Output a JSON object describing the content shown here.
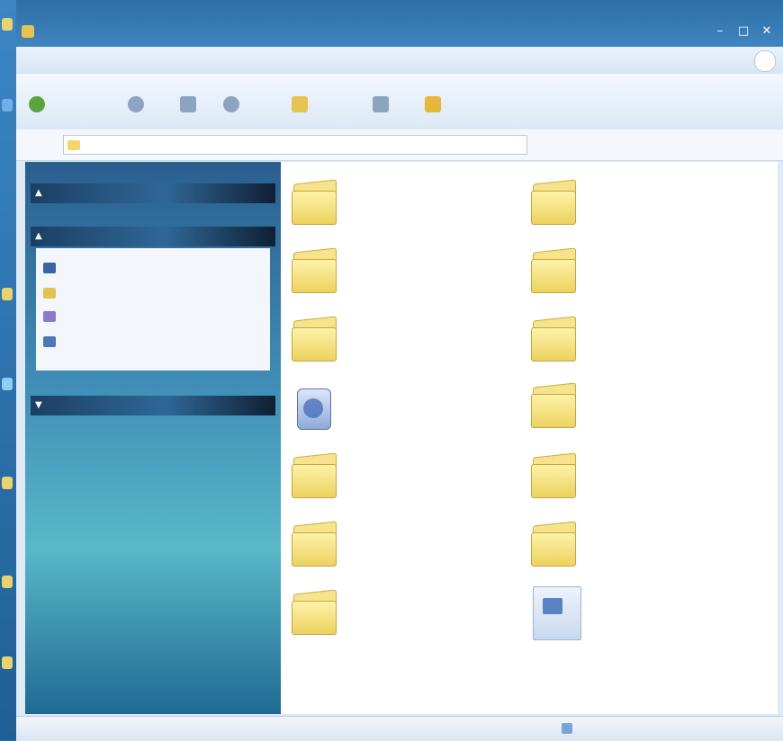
{
  "window": {
    "title": "",
    "controls": {
      "minimize": "–",
      "maximize": "□",
      "close": "✕"
    }
  },
  "menubar": {
    "items": [
      "",
      "",
      "",
      "",
      "",
      ""
    ]
  },
  "toolbar": {
    "buttons": [
      {
        "label": "",
        "icon": "back-arrow-icon",
        "color": "#5aa441"
      },
      {
        "label": "",
        "icon": "forward-arrow-icon",
        "color": "#8aa4c2"
      },
      {
        "label": "",
        "icon": "up-folder-icon",
        "color": "#8aa4c2"
      },
      {
        "label": "",
        "icon": "search-icon",
        "color": "#8aa4c2"
      },
      {
        "label": "",
        "icon": "folders-icon",
        "color": "#e6c44f"
      },
      {
        "label": "",
        "icon": "views-icon",
        "color": "#8aa4c2"
      },
      {
        "label": "",
        "icon": "folder-sync-icon",
        "color": "#e6b73a"
      }
    ]
  },
  "address": {
    "label": "",
    "value": "",
    "go": "",
    "links": ""
  },
  "taskpane": {
    "headers": [
      "",
      "",
      ""
    ],
    "tasks": [
      {
        "label": "",
        "icon": "new-folder-icon",
        "color": "#3c63a8"
      },
      {
        "label": "",
        "icon": "publish-icon",
        "color": "#e3c24f"
      },
      {
        "label": "",
        "icon": "share-icon",
        "color": "#8a7ad0"
      },
      {
        "label": "",
        "icon": "search-icon",
        "color": "#4c78b8"
      }
    ]
  },
  "items": [
    {
      "label": "",
      "type": "folder"
    },
    {
      "label": "",
      "type": "folder"
    },
    {
      "label": "",
      "type": "folder"
    },
    {
      "label": "",
      "type": "folder"
    },
    {
      "label": "",
      "type": "folder"
    },
    {
      "label": "",
      "type": "folder"
    },
    {
      "label": "",
      "type": "network"
    },
    {
      "label": "",
      "type": "folder"
    },
    {
      "label": "",
      "type": "folder"
    },
    {
      "label": "",
      "type": "folder"
    },
    {
      "label": "",
      "type": "folder"
    },
    {
      "label": "",
      "type": "folder"
    },
    {
      "label": "",
      "type": "folder"
    },
    {
      "label": "",
      "type": "document",
      "subtitle": ""
    }
  ],
  "status": {
    "left": "",
    "middle": "",
    "right": ""
  }
}
